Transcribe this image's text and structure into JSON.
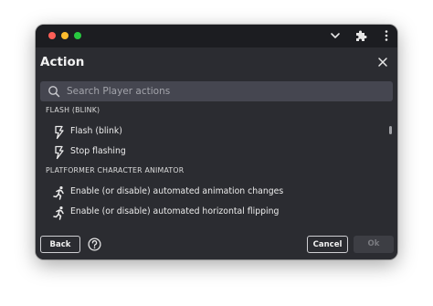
{
  "dialog": {
    "title": "Action",
    "search": {
      "placeholder": "Search Player actions",
      "value": ""
    },
    "groups": [
      {
        "header": "FLASH (BLINK)",
        "items": [
          {
            "label": "Flash (blink)",
            "icon": "flash-icon"
          },
          {
            "label": "Stop flashing",
            "icon": "flash-icon"
          }
        ]
      },
      {
        "header": "PLATFORMER CHARACTER ANIMATOR",
        "items": [
          {
            "label": "Enable (or disable) automated animation changes",
            "icon": "running-character-icon"
          },
          {
            "label": "Enable (or disable) automated horizontal flipping",
            "icon": "running-character-icon"
          }
        ]
      }
    ],
    "footer": {
      "back_label": "Back",
      "cancel_label": "Cancel",
      "ok_label": "Ok"
    }
  },
  "colors": {
    "window_bg": "#2b2c31",
    "titlebar_bg": "#1c1d21",
    "search_bg": "#454650",
    "text": "#ececec",
    "ok_disabled_bg": "#3d3e44"
  }
}
